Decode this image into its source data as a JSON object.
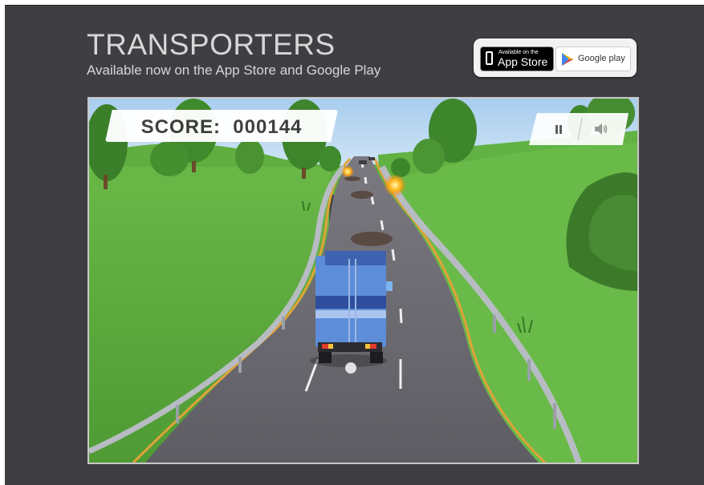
{
  "header": {
    "title": "TRANSPORTERS",
    "subtitle": "Available now on the App Store and Google Play"
  },
  "stores": {
    "appstore_small": "Available on the",
    "appstore_big": "App Store",
    "googleplay": "Google play"
  },
  "game": {
    "score_label": "SCORE:",
    "score_value": "000144",
    "pause_icon": "pause-icon",
    "sound_icon": "speaker-icon"
  },
  "colors": {
    "page_background": "#3f3e42",
    "header_text": "#d7d7d7",
    "sky": "#b9d8f2",
    "grass": "#5aa83c",
    "road": "#6b6a70",
    "truck": "#5b8fd6"
  }
}
